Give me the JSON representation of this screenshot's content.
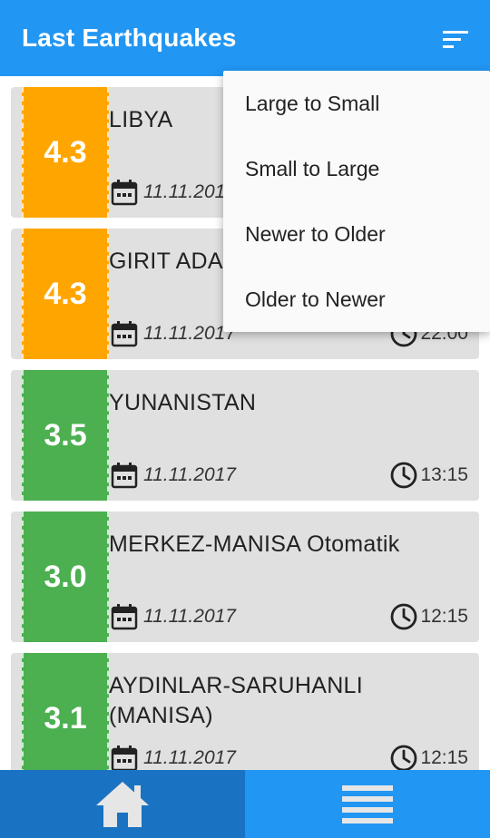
{
  "app": {
    "title": "Last Earthquakes"
  },
  "colors": {
    "primary": "#2196F3",
    "primary_dark": "#1A73C2",
    "orange": "#FFA500",
    "green": "#4CAF50",
    "card_bg": "#e0e0e0"
  },
  "icons": {
    "sort": "sort-icon",
    "calendar": "calendar-icon",
    "clock": "clock-icon",
    "home": "home-icon",
    "list": "list-icon"
  },
  "earthquakes": [
    {
      "magnitude": "4.3",
      "place": "LIBYA",
      "date": "11.11.2017",
      "time": "",
      "color": "orange"
    },
    {
      "magnitude": "4.3",
      "place": "GIRIT ADA",
      "date": "11.11.2017",
      "time": "22:00",
      "color": "orange"
    },
    {
      "magnitude": "3.5",
      "place": "YUNANISTAN",
      "date": "11.11.2017",
      "time": "13:15",
      "color": "green"
    },
    {
      "magnitude": "3.0",
      "place": "MERKEZ-MANISA Otomatik",
      "date": "11.11.2017",
      "time": "12:15",
      "color": "green"
    },
    {
      "magnitude": "3.1",
      "place": "AYDINLAR-SARUHANLI (MANISA)",
      "date": "11.11.2017",
      "time": "12:15",
      "color": "green"
    }
  ],
  "sort_menu": {
    "items": [
      "Large to Small",
      "Small to Large",
      "Newer to Older",
      "Older to Newer"
    ]
  },
  "bottom_nav": {
    "tabs": [
      "home",
      "list"
    ]
  }
}
